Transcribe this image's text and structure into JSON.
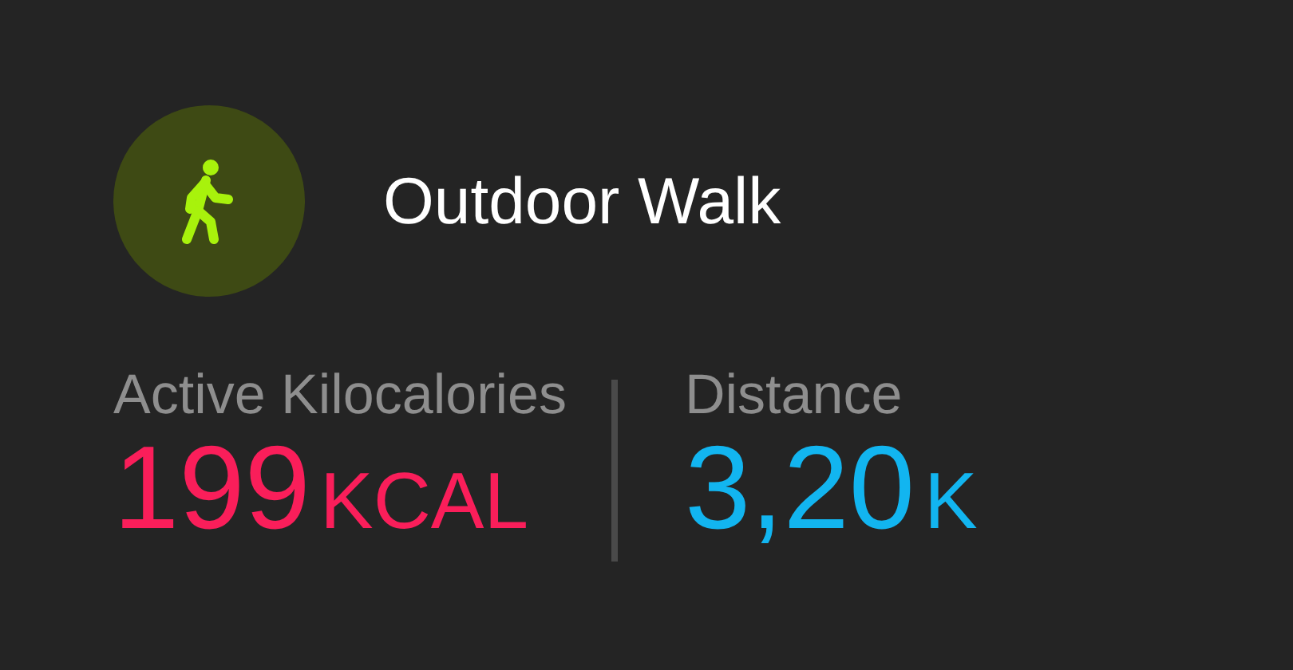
{
  "workout": {
    "title": "Outdoor Walk"
  },
  "metrics": [
    {
      "label": "Active Kilocalories",
      "value": "199",
      "unit": "KCAL",
      "color": "#fa1e5a"
    },
    {
      "label": "Distance",
      "value": "3,20",
      "unit": "K",
      "color": "#12b5f0"
    }
  ]
}
